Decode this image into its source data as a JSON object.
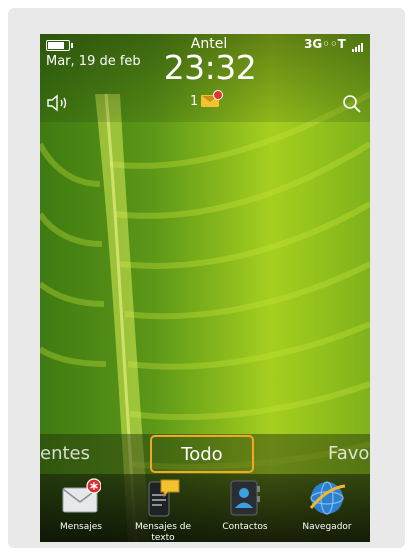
{
  "status_bar": {
    "date": "Mar, 19 de feb",
    "carrier": "Antel",
    "time": "23:32",
    "network": "3G",
    "network_suffix": "◦◦T"
  },
  "notifications": {
    "count": "1"
  },
  "tabs": {
    "left": "entes",
    "active": "Todo",
    "right": "Favoritos"
  },
  "dock": [
    {
      "label": "Mensajes",
      "icon": "envelope-icon"
    },
    {
      "label": "Mensajes de texto",
      "icon": "text-message-icon"
    },
    {
      "label": "Contactos",
      "icon": "contacts-icon"
    },
    {
      "label": "Navegador",
      "icon": "globe-icon"
    }
  ],
  "colors": {
    "accent": "#f5a623",
    "wallpaper": "#6aa11f"
  }
}
